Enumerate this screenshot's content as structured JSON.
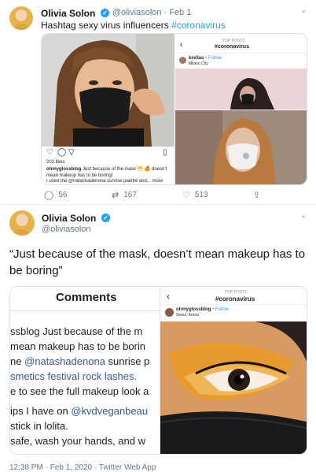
{
  "tweet1": {
    "name": "Olivia Solon",
    "handle": "@oliviasolon",
    "sep": "·",
    "date": "Feb 1",
    "text_prefix": "Hashtag sexy virus influencers ",
    "hashtag": "#coronavirus",
    "ig_post": {
      "likes": "202 likes",
      "caption_user": "ohmyglossblog",
      "caption_text": "Just because of the mask 😷 🍊 doesn't mean makeup has to be boring!",
      "caption_line2": "I used the @natashadenona sunrise palette and... more"
    },
    "top_posts": {
      "header_small": "TOP POSTS",
      "hashtag": "#coronavirus",
      "user": "brellas",
      "follow": "• Follow",
      "location": "Milano City"
    },
    "actions": {
      "replies": "56",
      "retweets": "167",
      "likes": "513"
    }
  },
  "tweet2": {
    "name": "Olivia Solon",
    "handle": "@oliviasolon",
    "quote": "“Just because of the mask, doesn’t mean makeup has to be boring”",
    "comments_title": "Comments",
    "comment_lines": [
      "ssblog Just because of the m",
      "mean makeup has to be borin",
      "ne ",
      "smetics festival rock lashes.",
      "e to see the full makeup look a",
      "ips I have on ",
      "stick in lolita.",
      "safe, wash your hands, and w"
    ],
    "comment_mentions": {
      "line3": "@natashadenona",
      "line3_tail": " sunrise p",
      "line6": "@kvdveganbeau"
    },
    "top_posts": {
      "header_small": "TOP POSTS",
      "hashtag": "#coronavirus",
      "user": "ohmyglossblog",
      "follow": "• Follow",
      "location": "Seoul, Korea"
    },
    "footer": "12:38 PM · Feb 1, 2020 · Twitter Web App"
  }
}
